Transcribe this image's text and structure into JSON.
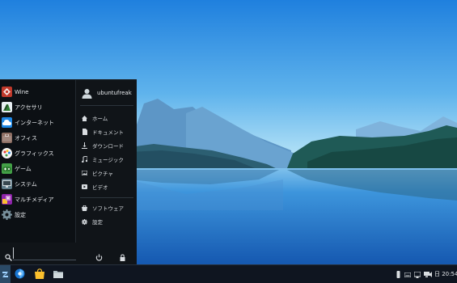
{
  "menu": {
    "apps": [
      {
        "label": "Wine",
        "icon": "wine-icon",
        "color": "#c0392b"
      },
      {
        "label": "アクセサリ",
        "icon": "accessories-icon",
        "color": "#2e7d32"
      },
      {
        "label": "インターネット",
        "icon": "internet-icon",
        "color": "#1e88e5"
      },
      {
        "label": "オフィス",
        "icon": "office-icon",
        "color": "#8d6e63"
      },
      {
        "label": "グラフィックス",
        "icon": "graphics-icon",
        "color": "#f5f5f5"
      },
      {
        "label": "ゲーム",
        "icon": "games-icon",
        "color": "#43a047"
      },
      {
        "label": "システム",
        "icon": "system-icon",
        "color": "#607d8b"
      },
      {
        "label": "マルチメディア",
        "icon": "multimedia-icon",
        "color": "#8e24aa"
      },
      {
        "label": "設定",
        "icon": "settings-icon",
        "color": "#5f6b75"
      }
    ],
    "user": {
      "name": "ubuntufreak"
    },
    "places": [
      {
        "label": "ホーム",
        "icon": "home-icon"
      },
      {
        "label": "ドキュメント",
        "icon": "document-icon"
      },
      {
        "label": "ダウンロード",
        "icon": "download-icon"
      },
      {
        "label": "ミュージック",
        "icon": "music-icon"
      },
      {
        "label": "ピクチャ",
        "icon": "picture-icon"
      },
      {
        "label": "ビデオ",
        "icon": "video-icon"
      }
    ],
    "system": [
      {
        "label": "ソフトウェア",
        "icon": "software-icon"
      },
      {
        "label": "設定",
        "icon": "settings-gear-icon"
      }
    ],
    "search": {
      "placeholder": ""
    }
  },
  "taskbar": {
    "pinned": [
      "zorin-menu-icon",
      "browser-icon",
      "software-store-icon",
      "files-icon"
    ],
    "tray": [
      "usb-icon",
      "keyboard-icon",
      "network-icon",
      "display-icon",
      "volume-icon"
    ],
    "clock": "日 20:54"
  },
  "colors": {
    "sky_top": "#1e7fde",
    "sky_bottom": "#bfe6f7",
    "lake": "#1b6fc4",
    "menu_bg": "#101418",
    "taskbar_bg": "#0f1520"
  }
}
